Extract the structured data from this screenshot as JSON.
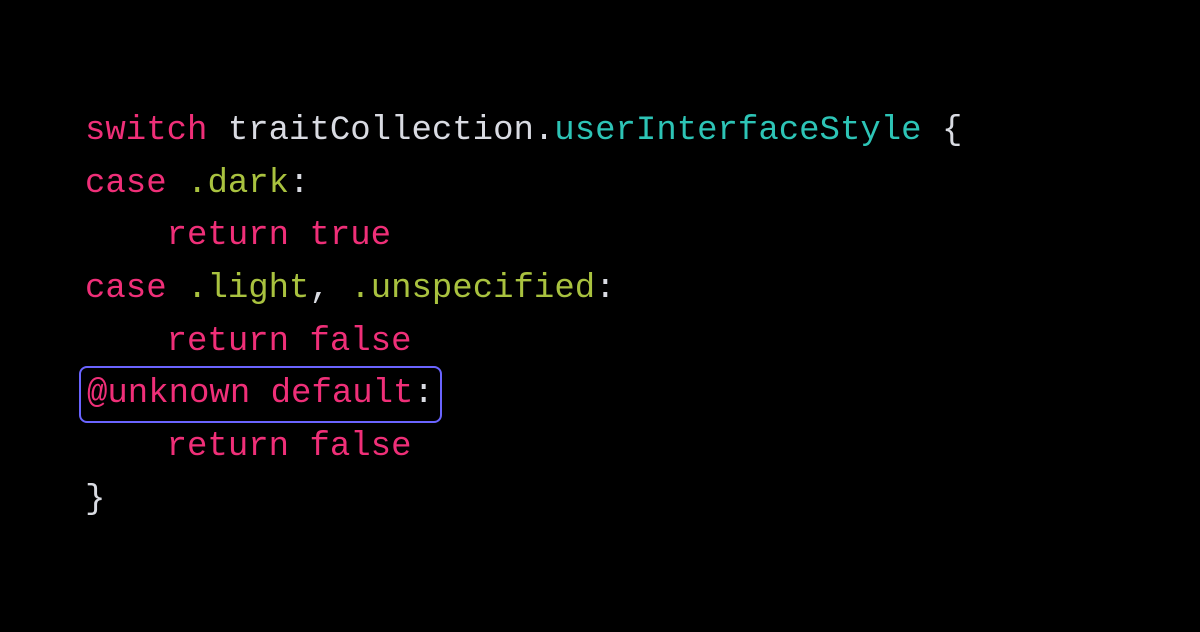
{
  "code": {
    "l1": {
      "switch": "switch",
      "sp": " ",
      "id": "traitCollection",
      "dot": ".",
      "prop": "userInterfaceStyle",
      "sp2": " ",
      "brace": "{"
    },
    "l2": {
      "case": "case",
      "sp": " ",
      "dot": ".",
      "t": "dark",
      "colon": ":"
    },
    "l3": {
      "indent": "    ",
      "ret": "return",
      "sp": " ",
      "val": "true"
    },
    "l4": {
      "case": "case",
      "sp": " ",
      "dot1": ".",
      "t1": "light",
      "comma": ", ",
      "dot2": ".",
      "t2": "unspecified",
      "colon": ":"
    },
    "l5": {
      "indent": "    ",
      "ret": "return",
      "sp": " ",
      "val": "false"
    },
    "l6": {
      "at": "@unknown",
      "sp": " ",
      "def": "default",
      "colon": ":"
    },
    "l7": {
      "indent": "    ",
      "ret": "return",
      "sp": " ",
      "val": "false"
    },
    "l8": {
      "brace": "}"
    }
  }
}
